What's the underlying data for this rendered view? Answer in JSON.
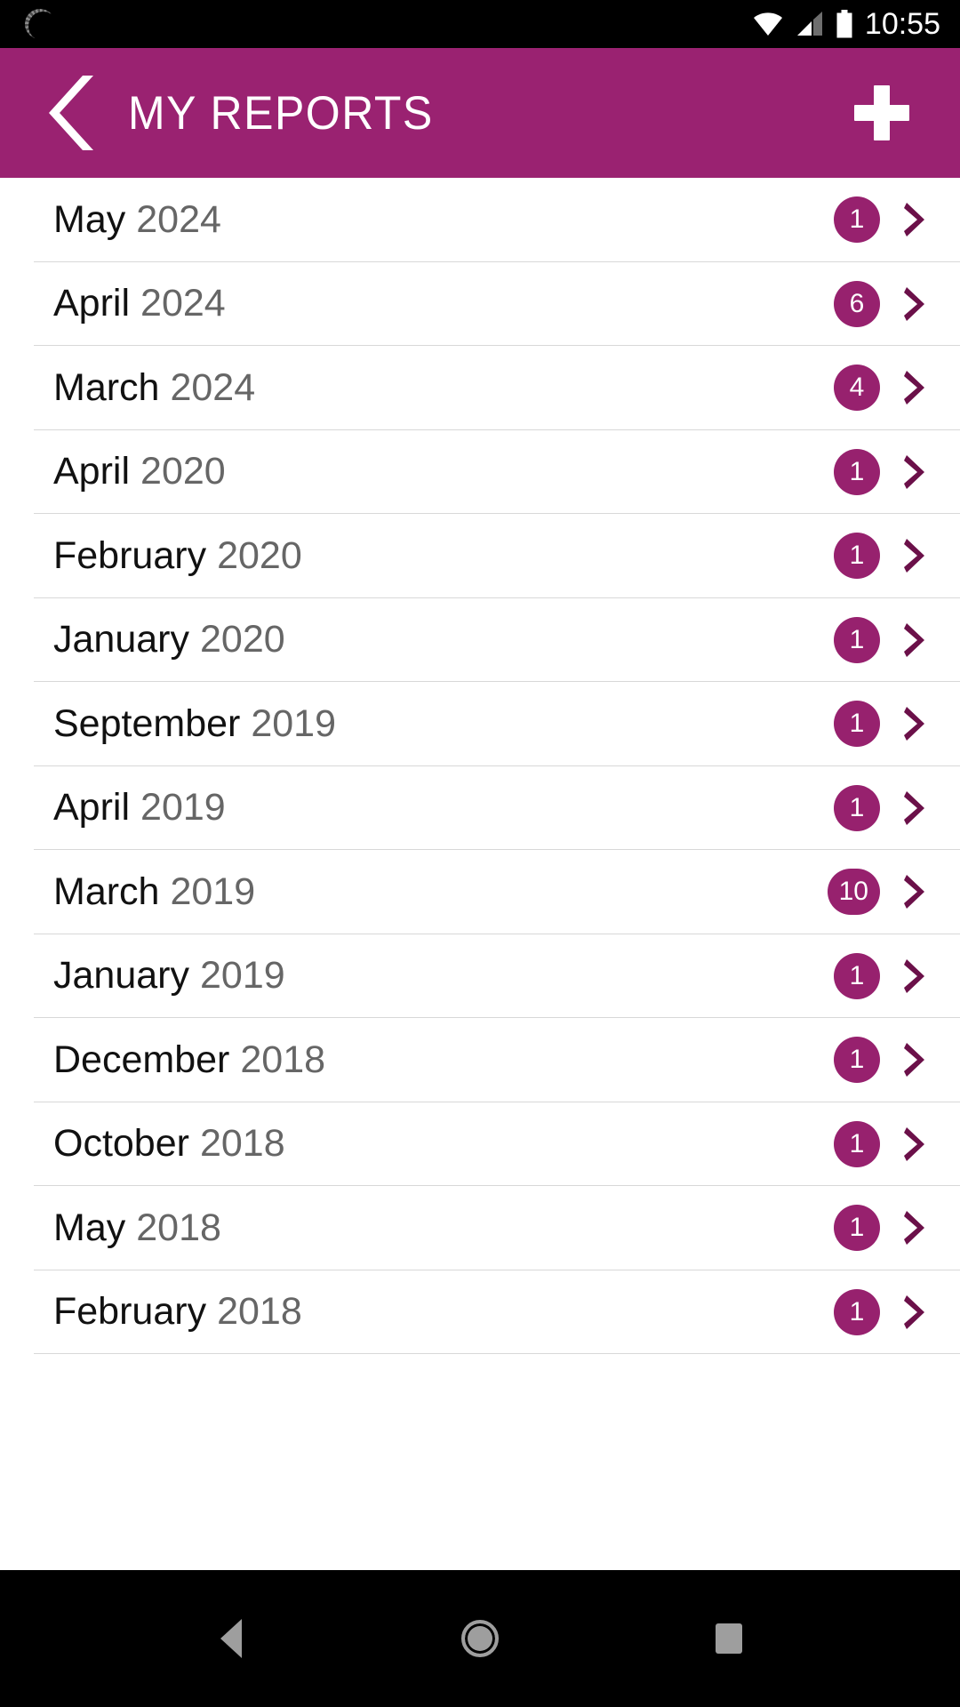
{
  "status_bar": {
    "left_icons": [
      {
        "name": "sync-spinner-icon",
        "label": "sync"
      }
    ],
    "right_icons": [
      {
        "name": "wifi-icon",
        "label": "wifi"
      },
      {
        "name": "cellular-signal-icon",
        "label": "signal"
      },
      {
        "name": "battery-icon",
        "label": "battery"
      }
    ],
    "time": "10:55"
  },
  "app_bar": {
    "back_label": "back",
    "title": "MY REPORTS",
    "add_label": "add report"
  },
  "colors": {
    "header": "#9a2271",
    "badge": "#97216e",
    "chevron": "#6b1049",
    "divider": "#d8d8d8",
    "month_text": "#111111",
    "year_text": "#666666",
    "status_bar": "#000000",
    "nav_bar": "#000000"
  },
  "list": {
    "items": [
      {
        "month": "May",
        "year": "2024",
        "count": "1"
      },
      {
        "month": "April",
        "year": "2024",
        "count": "6"
      },
      {
        "month": "March",
        "year": "2024",
        "count": "4"
      },
      {
        "month": "April",
        "year": "2020",
        "count": "1"
      },
      {
        "month": "February",
        "year": "2020",
        "count": "1"
      },
      {
        "month": "January",
        "year": "2020",
        "count": "1"
      },
      {
        "month": "September",
        "year": "2019",
        "count": "1"
      },
      {
        "month": "April",
        "year": "2019",
        "count": "1"
      },
      {
        "month": "March",
        "year": "2019",
        "count": "10"
      },
      {
        "month": "January",
        "year": "2019",
        "count": "1"
      },
      {
        "month": "December",
        "year": "2018",
        "count": "1"
      },
      {
        "month": "October",
        "year": "2018",
        "count": "1"
      },
      {
        "month": "May",
        "year": "2018",
        "count": "1"
      },
      {
        "month": "February",
        "year": "2018",
        "count": "1"
      }
    ]
  },
  "nav_bar": {
    "back_label": "Back",
    "home_label": "Home",
    "recents_label": "Recents"
  }
}
